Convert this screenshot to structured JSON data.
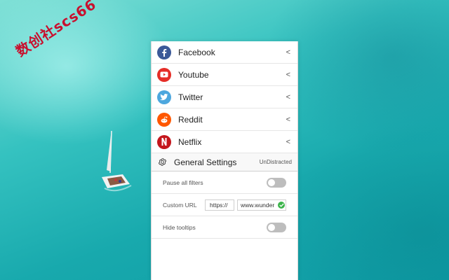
{
  "watermark": "数创社scs66",
  "sites": [
    {
      "label": "Facebook",
      "icon": "facebook-icon",
      "color": "#3b5998",
      "chevron": "<"
    },
    {
      "label": "Youtube",
      "icon": "youtube-icon",
      "color": "#e52d27",
      "chevron": "<"
    },
    {
      "label": "Twitter",
      "icon": "twitter-icon",
      "color": "#4da7de",
      "chevron": "<"
    },
    {
      "label": "Reddit",
      "icon": "reddit-icon",
      "color": "#ff5700",
      "chevron": "<"
    },
    {
      "label": "Netflix",
      "icon": "netflix-icon",
      "color": "#c4161c",
      "chevron": "<"
    }
  ],
  "settings": {
    "title": "General Settings",
    "brand": "UnDistracted",
    "pause_all_filters": {
      "label": "Pause all filters",
      "enabled": false
    },
    "custom_url": {
      "label": "Custom URL",
      "prefix": "https://",
      "value": "www.wunder",
      "valid": true
    },
    "hide_tooltips": {
      "label": "Hide tooltips",
      "enabled": false
    }
  },
  "colors": {
    "toggle_off": "#bdbdbd",
    "valid_green": "#3cb44b"
  }
}
